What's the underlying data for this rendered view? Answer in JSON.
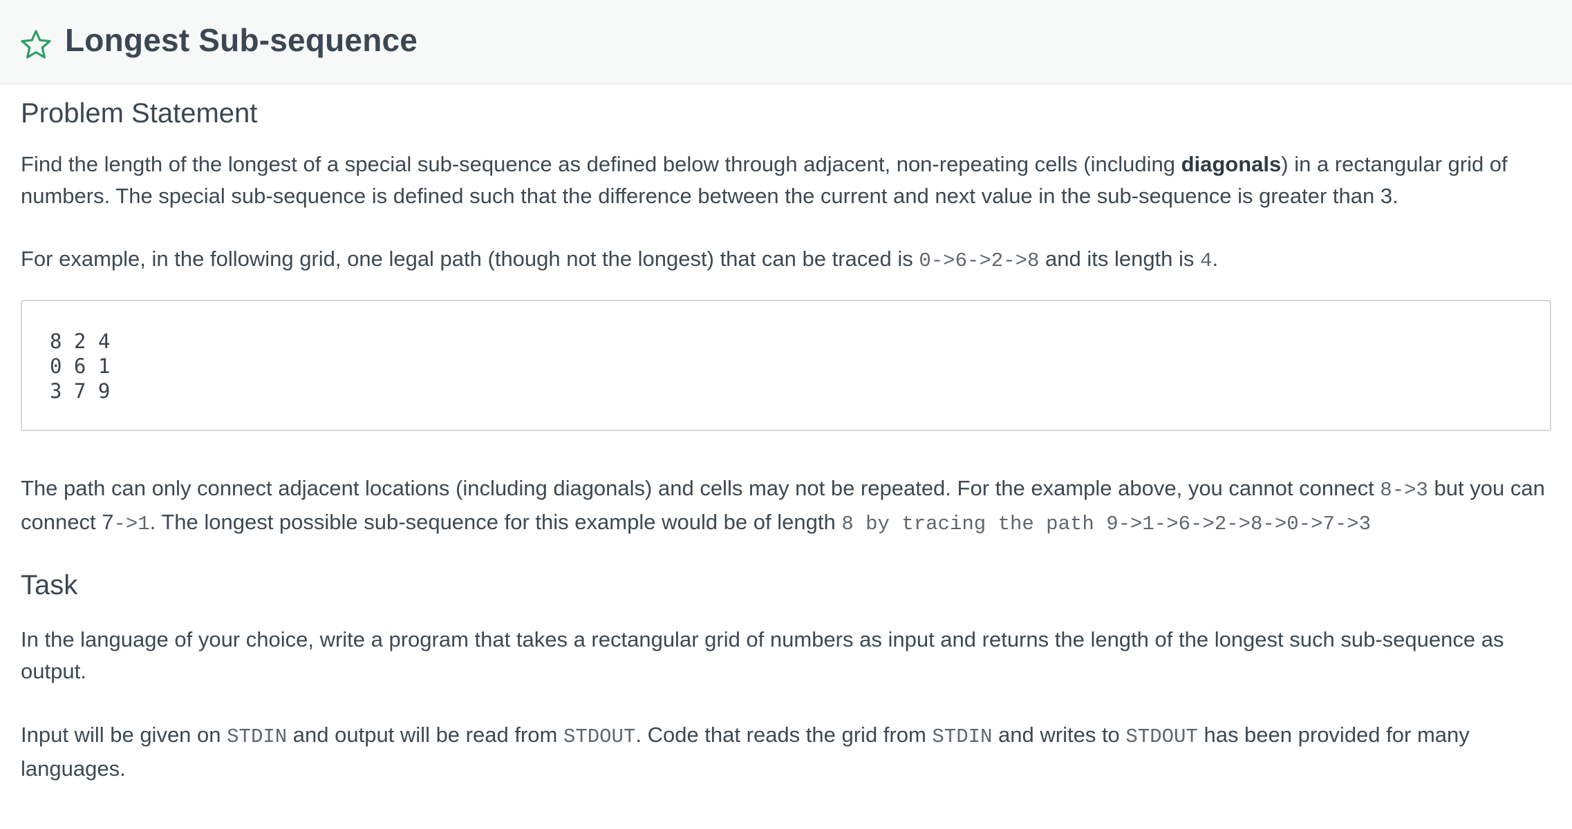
{
  "header": {
    "title": "Longest Sub-sequence",
    "star_icon": "star-outline-icon",
    "star_color": "#2e9e66"
  },
  "problem": {
    "heading": "Problem Statement",
    "p1": {
      "part1": "Find the length of the longest of a special sub-sequence as defined below through adjacent, non-repeating cells (including ",
      "bold": "diagonals",
      "part2": ") in a rectangular grid of numbers. The special sub-sequence is defined such that the difference between the current and next value in the sub-sequence is greater than 3."
    },
    "p2": {
      "part1": "For example, in the following grid, one legal path (though not the longest) that can be traced is ",
      "code1": "0->6->2->8",
      "part2": " and its length is ",
      "code2": "4",
      "part3": "."
    },
    "grid_lines": [
      "8 2 4",
      "0 6 1",
      "3 7 9"
    ],
    "p3": {
      "part1": "The path can only connect adjacent locations (including diagonals) and cells may not be repeated. For the example above, you cannot connect ",
      "code1": "8->3",
      "part2": "  but you can connect 7",
      "code2": "->1",
      "part3": ". The longest possible sub-sequence for this example would be of length ",
      "code3": "8 by tracing the path 9->1->6->2->8->0->7->3"
    }
  },
  "task": {
    "heading": "Task",
    "p1": "In the language of your choice, write a program that takes a rectangular grid of numbers as input and returns the length of the longest such sub-sequence as output.",
    "p2": {
      "part1": "Input will be given on ",
      "code1": "STDIN",
      "part2": " and output will be read from ",
      "code2": "STDOUT",
      "part3": ". Code that reads the grid from ",
      "code3": "STDIN",
      "part4": " and writes to ",
      "code4": "STDOUT",
      "part5": " has been provided for many languages."
    }
  }
}
